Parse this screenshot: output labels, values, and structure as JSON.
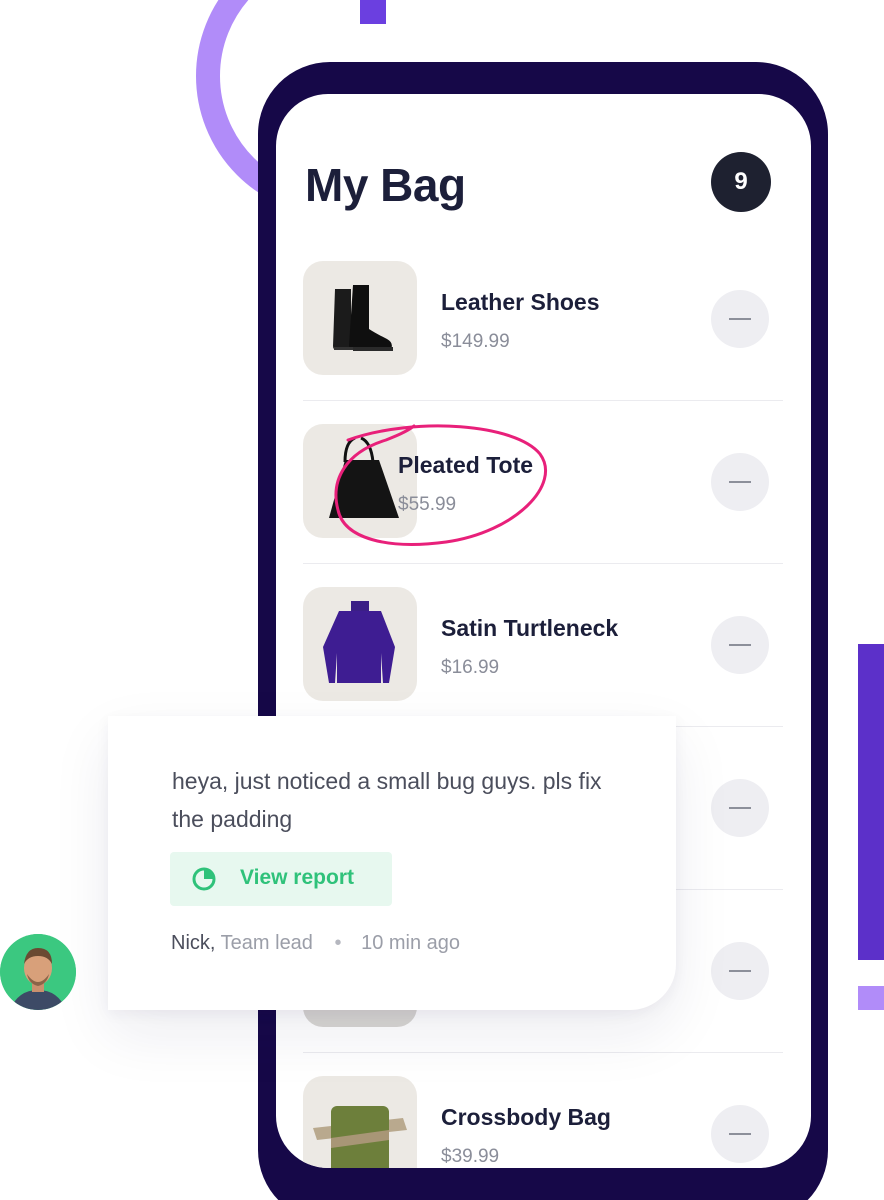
{
  "bag": {
    "title": "My Bag",
    "count": "9",
    "items": [
      {
        "name": "Leather Shoes",
        "price": "$149.99"
      },
      {
        "name": "Pleated Tote",
        "price": "$55.99"
      },
      {
        "name": "Satin Turtleneck",
        "price": "$16.99"
      },
      {
        "name": "",
        "price": ""
      },
      {
        "name": "",
        "price": ""
      },
      {
        "name": "Crossbody Bag",
        "price": "$39.99"
      }
    ]
  },
  "comment": {
    "message": "heya, just noticed a small bug guys. pls fix the padding",
    "button_label": "View report",
    "author": "Nick,",
    "role": "Team lead",
    "separator": "•",
    "time": "10 min ago"
  },
  "colors": {
    "phone_frame": "#160848",
    "accent_purple": "#5c30c9",
    "light_purple": "#b18cf9",
    "annotation_pink": "#e8207a",
    "report_green": "#2fc27a"
  }
}
